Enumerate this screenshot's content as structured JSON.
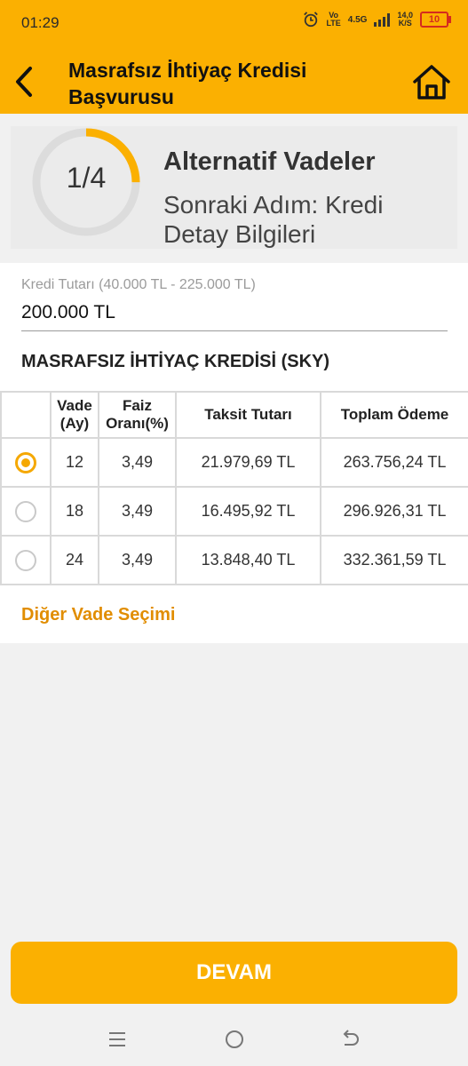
{
  "status_bar": {
    "time": "01:29",
    "network_top": "Vo",
    "network_bottom": "LTE",
    "network_type": "4.5G",
    "speed_top": "14,0",
    "speed_bottom": "K/S",
    "battery": "10"
  },
  "header": {
    "title": "Masrafsız İhtiyaç Kredisi Başvurusu",
    "back_icon": "chevron-left-icon",
    "home_icon": "home-icon"
  },
  "progress": {
    "step_label": "1/4",
    "fraction": 0.25,
    "title": "Alternatif Vadeler",
    "next_step": "Sonraki Adım: Kredi Detay Bilgileri"
  },
  "loan": {
    "amount_label": "Kredi Tutarı (40.000 TL - 225.000 TL)",
    "amount_value": "200.000 TL"
  },
  "product_title": "MASRAFSIZ İHTİYAÇ KREDİSİ (SKY)",
  "table": {
    "headers": {
      "term": "Vade (Ay)",
      "rate": "Faiz Oranı(%)",
      "installment": "Taksit Tutarı",
      "total": "Toplam Ödeme"
    },
    "rows": [
      {
        "selected": true,
        "term": "12",
        "rate": "3,49",
        "installment": "21.979,69 TL",
        "total": "263.756,24 TL"
      },
      {
        "selected": false,
        "term": "18",
        "rate": "3,49",
        "installment": "16.495,92 TL",
        "total": "296.926,31 TL"
      },
      {
        "selected": false,
        "term": "24",
        "rate": "3,49",
        "installment": "13.848,40 TL",
        "total": "332.361,59 TL"
      }
    ]
  },
  "other_term_link": "Diğer Vade Seçimi",
  "continue_button": "DEVAM",
  "colors": {
    "brand": "#fbb001",
    "accent_text": "#e18d00",
    "radio_selected": "#f5a800"
  }
}
